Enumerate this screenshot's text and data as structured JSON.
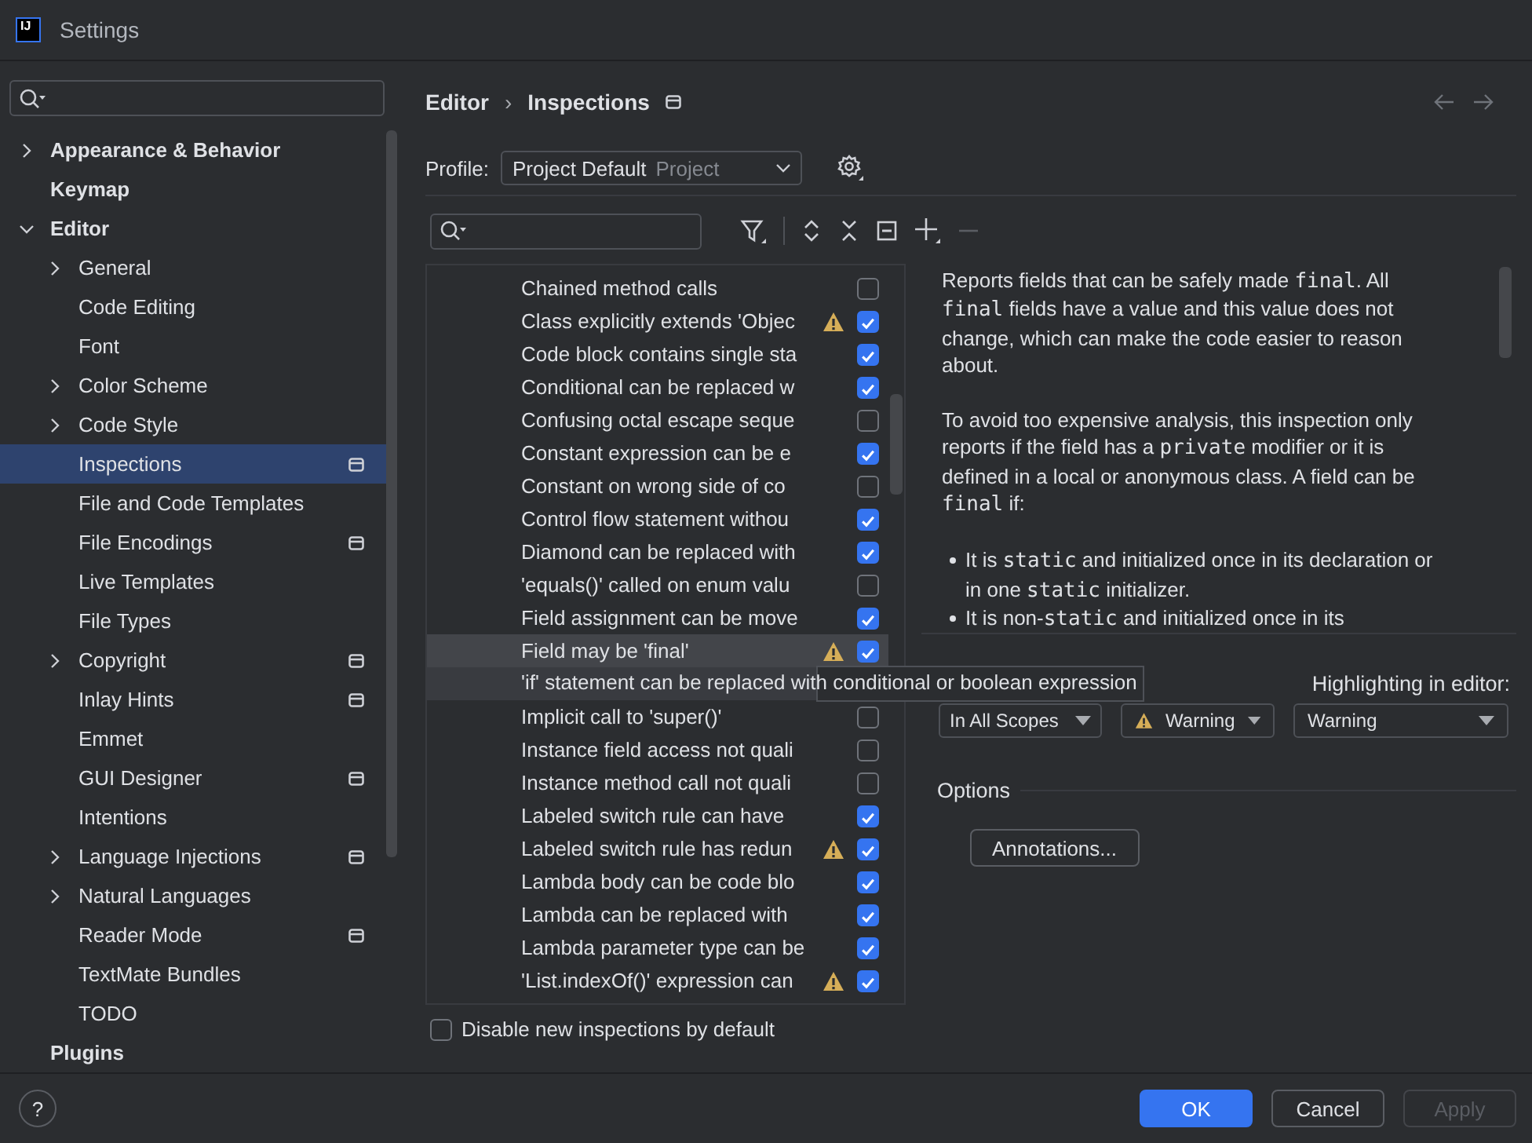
{
  "window": {
    "logo_text": "IJ",
    "title": "Settings"
  },
  "sidebar": {
    "items": [
      {
        "label": "Appearance & Behavior",
        "kind": "folder",
        "expanded": false,
        "selected": false,
        "project_level": false
      },
      {
        "label": "Keymap",
        "kind": "page",
        "selected": false,
        "project_level": false
      },
      {
        "label": "Editor",
        "kind": "folder",
        "expanded": true,
        "selected": false,
        "project_level": false,
        "children": [
          {
            "label": "General",
            "kind": "folder",
            "expanded": false,
            "selected": false,
            "project_level": false
          },
          {
            "label": "Code Editing",
            "kind": "page",
            "selected": false,
            "project_level": false
          },
          {
            "label": "Font",
            "kind": "page",
            "selected": false,
            "project_level": false
          },
          {
            "label": "Color Scheme",
            "kind": "folder",
            "expanded": false,
            "selected": false,
            "project_level": false
          },
          {
            "label": "Code Style",
            "kind": "folder",
            "expanded": false,
            "selected": false,
            "project_level": false
          },
          {
            "label": "Inspections",
            "kind": "page",
            "selected": true,
            "project_level": true
          },
          {
            "label": "File and Code Templates",
            "kind": "page",
            "selected": false,
            "project_level": false
          },
          {
            "label": "File Encodings",
            "kind": "page",
            "selected": false,
            "project_level": true
          },
          {
            "label": "Live Templates",
            "kind": "page",
            "selected": false,
            "project_level": false
          },
          {
            "label": "File Types",
            "kind": "page",
            "selected": false,
            "project_level": false
          },
          {
            "label": "Copyright",
            "kind": "folder",
            "expanded": false,
            "selected": false,
            "project_level": true
          },
          {
            "label": "Inlay Hints",
            "kind": "page",
            "selected": false,
            "project_level": true
          },
          {
            "label": "Emmet",
            "kind": "page",
            "selected": false,
            "project_level": false
          },
          {
            "label": "GUI Designer",
            "kind": "page",
            "selected": false,
            "project_level": true
          },
          {
            "label": "Intentions",
            "kind": "page",
            "selected": false,
            "project_level": false
          },
          {
            "label": "Language Injections",
            "kind": "folder",
            "expanded": false,
            "selected": false,
            "project_level": true
          },
          {
            "label": "Natural Languages",
            "kind": "folder",
            "expanded": false,
            "selected": false,
            "project_level": false
          },
          {
            "label": "Reader Mode",
            "kind": "page",
            "selected": false,
            "project_level": true
          },
          {
            "label": "TextMate Bundles",
            "kind": "page",
            "selected": false,
            "project_level": false
          },
          {
            "label": "TODO",
            "kind": "page",
            "selected": false,
            "project_level": false
          }
        ]
      },
      {
        "label": "Plugins",
        "kind": "page",
        "selected": false,
        "project_level": false
      }
    ]
  },
  "breadcrumb": {
    "parent": "Editor",
    "separator": "›",
    "current": "Inspections"
  },
  "profile": {
    "label": "Profile:",
    "value": "Project Default",
    "scope": "Project"
  },
  "inspections": [
    {
      "label": "Chained method calls",
      "kind": "row",
      "warning": false,
      "checked": false,
      "selected": false
    },
    {
      "label": "Class explicitly extends 'Objec",
      "kind": "row",
      "warning": true,
      "checked": true,
      "selected": false
    },
    {
      "label": "Code block contains single sta",
      "kind": "row",
      "warning": false,
      "checked": true,
      "selected": false
    },
    {
      "label": "Conditional can be replaced w",
      "kind": "row",
      "warning": false,
      "checked": true,
      "selected": false
    },
    {
      "label": "Confusing octal escape seque",
      "kind": "row",
      "warning": false,
      "checked": false,
      "selected": false
    },
    {
      "label": "Constant expression can be e",
      "kind": "row",
      "warning": false,
      "checked": true,
      "selected": false
    },
    {
      "label": "Constant on wrong side of co",
      "kind": "row",
      "warning": false,
      "checked": false,
      "selected": false
    },
    {
      "label": "Control flow statement withou",
      "kind": "row",
      "warning": false,
      "checked": true,
      "selected": false
    },
    {
      "label": "Diamond can be replaced with",
      "kind": "row",
      "warning": false,
      "checked": true,
      "selected": false
    },
    {
      "label": "'equals()' called on enum valu",
      "kind": "row",
      "warning": false,
      "checked": false,
      "selected": false
    },
    {
      "label": "Field assignment can be move",
      "kind": "row",
      "warning": false,
      "checked": true,
      "selected": false
    },
    {
      "label": "Field may be 'final'",
      "kind": "row",
      "warning": true,
      "checked": true,
      "selected": true
    },
    {
      "label": "'if' statement can be replaced with conditional or boolean expression",
      "kind": "tooltip",
      "selected": false
    },
    {
      "label": "Implicit call to 'super()'",
      "kind": "row",
      "warning": false,
      "checked": false,
      "selected": false
    },
    {
      "label": "Instance field access not quali",
      "kind": "row",
      "warning": false,
      "checked": false,
      "selected": false
    },
    {
      "label": "Instance method call not quali",
      "kind": "row",
      "warning": false,
      "checked": false,
      "selected": false
    },
    {
      "label": "Labeled switch rule can have",
      "kind": "row",
      "warning": false,
      "checked": true,
      "selected": false
    },
    {
      "label": "Labeled switch rule has redun",
      "kind": "row",
      "warning": true,
      "checked": true,
      "selected": false
    },
    {
      "label": "Lambda body can be code blo",
      "kind": "row",
      "warning": false,
      "checked": true,
      "selected": false
    },
    {
      "label": "Lambda can be replaced with",
      "kind": "row",
      "warning": false,
      "checked": true,
      "selected": false
    },
    {
      "label": "Lambda parameter type can be",
      "kind": "row",
      "warning": false,
      "checked": true,
      "selected": false
    },
    {
      "label": "'List.indexOf()' expression can",
      "kind": "row",
      "warning": true,
      "checked": true,
      "selected": false
    }
  ],
  "disable_new": {
    "label": "Disable new inspections by default",
    "checked": false
  },
  "description": {
    "paragraphs": [
      "Reports fields that can be safely made *final*. All *final* fields have a value and this value does not change, which can make the code easier to reason about.",
      "To avoid too expensive analysis, this inspection only reports if the field has a *private* modifier or it is defined in a local or anonymous class. A field can be *final* if:"
    ],
    "bullets": [
      "It is *static* and initialized once in its declaration or in one *static* initializer.",
      "It is non-*static* and initialized once in its"
    ]
  },
  "highlighting_label": "Highlighting in editor:",
  "scope_dropdown": "In All Scopes",
  "severity_dropdown": {
    "value": "Warning",
    "warning": true
  },
  "highlighting_dropdown": "Warning",
  "options": {
    "title": "Options",
    "button": "Annotations..."
  },
  "footer": {
    "help": "?",
    "buttons": [
      {
        "label": "OK",
        "kind": "primary"
      },
      {
        "label": "Cancel",
        "kind": "normal"
      },
      {
        "label": "Apply",
        "kind": "disabled"
      }
    ]
  }
}
